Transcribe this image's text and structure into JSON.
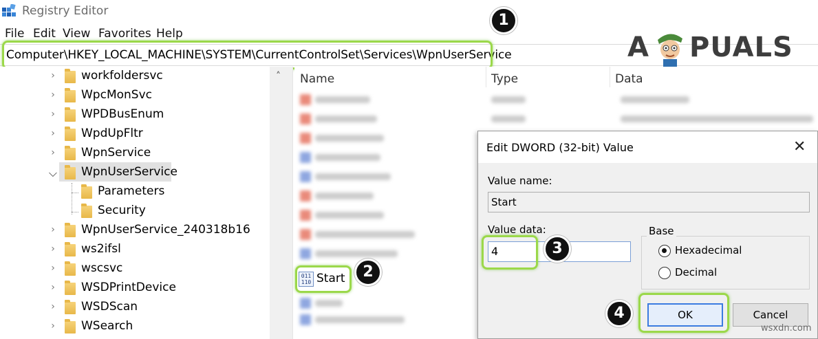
{
  "window": {
    "title": "Registry Editor"
  },
  "menu": [
    "File",
    "Edit",
    "View",
    "Favorites",
    "Help"
  ],
  "address": "Computer\\HKEY_LOCAL_MACHINE\\SYSTEM\\CurrentControlSet\\Services\\WpnUserService",
  "logo": {
    "left": "A",
    "right": "PUALS"
  },
  "tree": {
    "items": [
      {
        "label": "workfoldersvc"
      },
      {
        "label": "WpcMonSvc"
      },
      {
        "label": "WPDBusEnum"
      },
      {
        "label": "WpdUpFltr"
      },
      {
        "label": "WpnService"
      },
      {
        "label": "WpnUserService"
      },
      {
        "label": "Parameters"
      },
      {
        "label": "Security"
      },
      {
        "label": "WpnUserService_240318b16"
      },
      {
        "label": "ws2ifsl"
      },
      {
        "label": "wscsvc"
      },
      {
        "label": "WSDPrintDevice"
      },
      {
        "label": "WSDScan"
      },
      {
        "label": "WSearch"
      }
    ]
  },
  "list": {
    "columns": [
      "Name",
      "Type",
      "Data"
    ],
    "visible_item": "Start"
  },
  "dialog": {
    "title": "Edit DWORD (32-bit) Value",
    "value_name_label": "Value name:",
    "value_name": "Start",
    "value_data_label": "Value data:",
    "value_data": "4",
    "base_label": "Base",
    "radio_hex": "Hexadecimal",
    "radio_dec": "Decimal",
    "ok": "OK",
    "cancel": "Cancel"
  },
  "badges": [
    "1",
    "2",
    "3",
    "4"
  ],
  "watermark": "wsxdn.com",
  "colors": {
    "highlight": "#9bd84a",
    "folder": "#e8b849",
    "badge": "#111111"
  }
}
